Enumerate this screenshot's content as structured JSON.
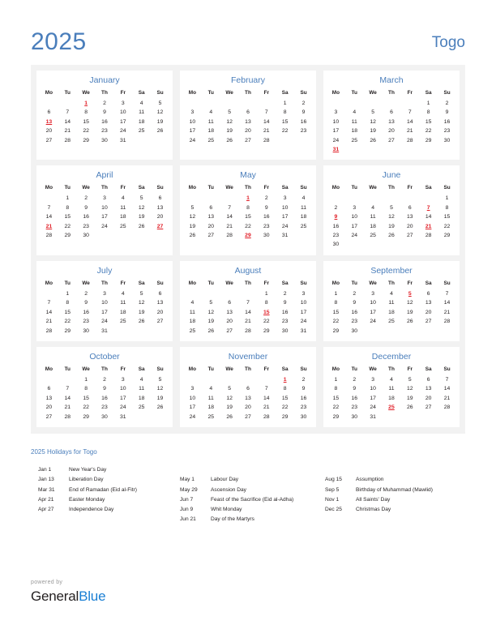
{
  "header": {
    "year": "2025",
    "country": "Togo",
    "accent_color": "#4a7ebb",
    "holiday_color": "#e01b24"
  },
  "weekday_headers": [
    "Mo",
    "Tu",
    "We",
    "Th",
    "Fr",
    "Sa",
    "Su"
  ],
  "months": [
    {
      "name": "January",
      "lead_blanks": 2,
      "days": 31,
      "holidays": [
        1,
        13
      ],
      "weeks": [
        [
          "",
          "",
          "1",
          "2",
          "3",
          "4",
          "5"
        ],
        [
          "6",
          "7",
          "8",
          "9",
          "10",
          "11",
          "12"
        ],
        [
          "13",
          "14",
          "15",
          "16",
          "17",
          "18",
          "19"
        ],
        [
          "20",
          "21",
          "22",
          "23",
          "24",
          "25",
          "26"
        ],
        [
          "27",
          "28",
          "29",
          "30",
          "31",
          "",
          ""
        ]
      ]
    },
    {
      "name": "February",
      "lead_blanks": 5,
      "days": 28,
      "holidays": [],
      "weeks": [
        [
          "",
          "",
          "",
          "",
          "",
          "1",
          "2"
        ],
        [
          "3",
          "4",
          "5",
          "6",
          "7",
          "8",
          "9"
        ],
        [
          "10",
          "11",
          "12",
          "13",
          "14",
          "15",
          "16"
        ],
        [
          "17",
          "18",
          "19",
          "20",
          "21",
          "22",
          "23"
        ],
        [
          "24",
          "25",
          "26",
          "27",
          "28",
          "",
          ""
        ]
      ]
    },
    {
      "name": "March",
      "lead_blanks": 5,
      "days": 31,
      "holidays": [
        31
      ],
      "weeks": [
        [
          "",
          "",
          "",
          "",
          "",
          "1",
          "2"
        ],
        [
          "3",
          "4",
          "5",
          "6",
          "7",
          "8",
          "9"
        ],
        [
          "10",
          "11",
          "12",
          "13",
          "14",
          "15",
          "16"
        ],
        [
          "17",
          "18",
          "19",
          "20",
          "21",
          "22",
          "23"
        ],
        [
          "24",
          "25",
          "26",
          "27",
          "28",
          "29",
          "30"
        ],
        [
          "31",
          "",
          "",
          "",
          "",
          "",
          ""
        ]
      ]
    },
    {
      "name": "April",
      "lead_blanks": 1,
      "days": 30,
      "holidays": [
        21,
        27
      ],
      "weeks": [
        [
          "",
          "1",
          "2",
          "3",
          "4",
          "5",
          "6"
        ],
        [
          "7",
          "8",
          "9",
          "10",
          "11",
          "12",
          "13"
        ],
        [
          "14",
          "15",
          "16",
          "17",
          "18",
          "19",
          "20"
        ],
        [
          "21",
          "22",
          "23",
          "24",
          "25",
          "26",
          "27"
        ],
        [
          "28",
          "29",
          "30",
          "",
          "",
          "",
          ""
        ]
      ]
    },
    {
      "name": "May",
      "lead_blanks": 3,
      "days": 31,
      "holidays": [
        1,
        29
      ],
      "weeks": [
        [
          "",
          "",
          "",
          "1",
          "2",
          "3",
          "4"
        ],
        [
          "5",
          "6",
          "7",
          "8",
          "9",
          "10",
          "11"
        ],
        [
          "12",
          "13",
          "14",
          "15",
          "16",
          "17",
          "18"
        ],
        [
          "19",
          "20",
          "21",
          "22",
          "23",
          "24",
          "25"
        ],
        [
          "26",
          "27",
          "28",
          "29",
          "30",
          "31",
          ""
        ]
      ]
    },
    {
      "name": "June",
      "lead_blanks": 6,
      "days": 30,
      "holidays": [
        7,
        9,
        21
      ],
      "weeks": [
        [
          "",
          "",
          "",
          "",
          "",
          "",
          "1"
        ],
        [
          "2",
          "3",
          "4",
          "5",
          "6",
          "7",
          "8"
        ],
        [
          "9",
          "10",
          "11",
          "12",
          "13",
          "14",
          "15"
        ],
        [
          "16",
          "17",
          "18",
          "19",
          "20",
          "21",
          "22"
        ],
        [
          "23",
          "24",
          "25",
          "26",
          "27",
          "28",
          "29"
        ],
        [
          "30",
          "",
          "",
          "",
          "",
          "",
          ""
        ]
      ]
    },
    {
      "name": "July",
      "lead_blanks": 1,
      "days": 31,
      "holidays": [],
      "weeks": [
        [
          "",
          "1",
          "2",
          "3",
          "4",
          "5",
          "6"
        ],
        [
          "7",
          "8",
          "9",
          "10",
          "11",
          "12",
          "13"
        ],
        [
          "14",
          "15",
          "16",
          "17",
          "18",
          "19",
          "20"
        ],
        [
          "21",
          "22",
          "23",
          "24",
          "25",
          "26",
          "27"
        ],
        [
          "28",
          "29",
          "30",
          "31",
          "",
          "",
          ""
        ]
      ]
    },
    {
      "name": "August",
      "lead_blanks": 4,
      "days": 31,
      "holidays": [
        15
      ],
      "weeks": [
        [
          "",
          "",
          "",
          "",
          "1",
          "2",
          "3"
        ],
        [
          "4",
          "5",
          "6",
          "7",
          "8",
          "9",
          "10"
        ],
        [
          "11",
          "12",
          "13",
          "14",
          "15",
          "16",
          "17"
        ],
        [
          "18",
          "19",
          "20",
          "21",
          "22",
          "23",
          "24"
        ],
        [
          "25",
          "26",
          "27",
          "28",
          "29",
          "30",
          "31"
        ]
      ]
    },
    {
      "name": "September",
      "lead_blanks": 0,
      "days": 30,
      "holidays": [
        5
      ],
      "weeks": [
        [
          "1",
          "2",
          "3",
          "4",
          "5",
          "6",
          "7"
        ],
        [
          "8",
          "9",
          "10",
          "11",
          "12",
          "13",
          "14"
        ],
        [
          "15",
          "16",
          "17",
          "18",
          "19",
          "20",
          "21"
        ],
        [
          "22",
          "23",
          "24",
          "25",
          "26",
          "27",
          "28"
        ],
        [
          "29",
          "30",
          "",
          "",
          "",
          "",
          ""
        ]
      ]
    },
    {
      "name": "October",
      "lead_blanks": 2,
      "days": 31,
      "holidays": [],
      "weeks": [
        [
          "",
          "",
          "1",
          "2",
          "3",
          "4",
          "5"
        ],
        [
          "6",
          "7",
          "8",
          "9",
          "10",
          "11",
          "12"
        ],
        [
          "13",
          "14",
          "15",
          "16",
          "17",
          "18",
          "19"
        ],
        [
          "20",
          "21",
          "22",
          "23",
          "24",
          "25",
          "26"
        ],
        [
          "27",
          "28",
          "29",
          "30",
          "31",
          "",
          ""
        ]
      ]
    },
    {
      "name": "November",
      "lead_blanks": 5,
      "days": 30,
      "holidays": [
        1
      ],
      "weeks": [
        [
          "",
          "",
          "",
          "",
          "",
          "1",
          "2"
        ],
        [
          "3",
          "4",
          "5",
          "6",
          "7",
          "8",
          "9"
        ],
        [
          "10",
          "11",
          "12",
          "13",
          "14",
          "15",
          "16"
        ],
        [
          "17",
          "18",
          "19",
          "20",
          "21",
          "22",
          "23"
        ],
        [
          "24",
          "25",
          "26",
          "27",
          "28",
          "29",
          "30"
        ]
      ]
    },
    {
      "name": "December",
      "lead_blanks": 0,
      "days": 31,
      "holidays": [
        25
      ],
      "weeks": [
        [
          "1",
          "2",
          "3",
          "4",
          "5",
          "6",
          "7"
        ],
        [
          "8",
          "9",
          "10",
          "11",
          "12",
          "13",
          "14"
        ],
        [
          "15",
          "16",
          "17",
          "18",
          "19",
          "20",
          "21"
        ],
        [
          "22",
          "23",
          "24",
          "25",
          "26",
          "27",
          "28"
        ],
        [
          "29",
          "30",
          "31",
          "",
          "",
          "",
          ""
        ]
      ]
    }
  ],
  "holidays_section": {
    "heading": "2025 Holidays for Togo",
    "columns": [
      [
        {
          "date": "Jan 1",
          "name": "New Year's Day"
        },
        {
          "date": "Jan 13",
          "name": "Liberation Day"
        },
        {
          "date": "Mar 31",
          "name": "End of Ramadan (Eid al-Fitr)"
        },
        {
          "date": "Apr 21",
          "name": "Easter Monday"
        },
        {
          "date": "Apr 27",
          "name": "Independence Day"
        }
      ],
      [
        {
          "date": "May 1",
          "name": "Labour Day"
        },
        {
          "date": "May 29",
          "name": "Ascension Day"
        },
        {
          "date": "Jun 7",
          "name": "Feast of the Sacrifice (Eid al-Adha)"
        },
        {
          "date": "Jun 9",
          "name": "Whit Monday"
        },
        {
          "date": "Jun 21",
          "name": "Day of the Martyrs"
        }
      ],
      [
        {
          "date": "Aug 15",
          "name": "Assumption"
        },
        {
          "date": "Sep 5",
          "name": "Birthday of Muhammad (Mawlid)"
        },
        {
          "date": "Nov 1",
          "name": "All Saints' Day"
        },
        {
          "date": "Dec 25",
          "name": "Christmas Day"
        }
      ]
    ],
    "column_offsets": [
      0,
      1,
      1
    ]
  },
  "footer": {
    "powered_by": "powered by",
    "brand_first": "General",
    "brand_second": "Blue"
  }
}
